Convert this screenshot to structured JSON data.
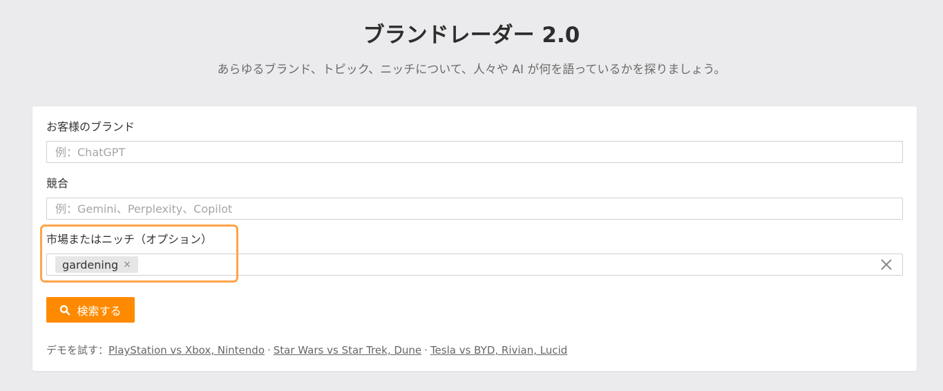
{
  "header": {
    "title": "ブランドレーダー 2.0",
    "subtitle": "あらゆるブランド、トピック、ニッチについて、人々や AI が何を語っているかを探りましょう。"
  },
  "form": {
    "brand": {
      "label": "お客様のブランド",
      "value": "",
      "placeholder": "例：ChatGPT"
    },
    "competitors": {
      "label": "競合",
      "value": "",
      "placeholder": "例：Gemini、Perplexity、Copilot"
    },
    "market": {
      "label": "市場またはニッチ（オプション）",
      "tags": [
        "gardening"
      ],
      "remove_glyph": "×"
    },
    "search_button": {
      "label": "検索する",
      "icon": "search-icon"
    }
  },
  "demo": {
    "prefix": "デモを試す：",
    "separator": "·",
    "links": [
      "PlayStation vs Xbox, Nintendo",
      "Star Wars vs Star Trek, Dune",
      "Tesla vs BYD, Rivian, Lucid"
    ]
  },
  "colors": {
    "accent": "#ff8a00",
    "highlight": "#ffa347",
    "background": "#ebebed"
  }
}
